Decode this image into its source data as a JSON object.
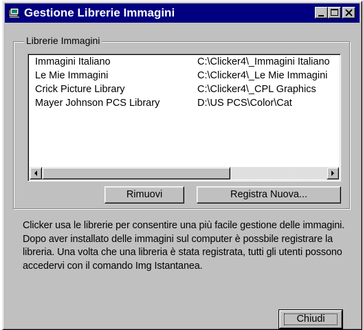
{
  "window": {
    "title": "Gestione Librerie Immagini",
    "icon": "app-icon"
  },
  "title_buttons": {
    "minimize_icon": "minimize-icon",
    "maximize_icon": "maximize-icon",
    "close_icon": "close-icon"
  },
  "group": {
    "label": "Librerie Immagini"
  },
  "libraries": [
    {
      "name": "Immagini Italiano",
      "path": "C:\\Clicker4\\_Immagini Italiano"
    },
    {
      "name": "Le Mie Immagini",
      "path": "C:\\Clicker4\\_Le Mie Immagini"
    },
    {
      "name": "Crick Picture Library",
      "path": "C:\\Clicker4\\_CPL Graphics"
    },
    {
      "name": "Mayer Johnson PCS Library",
      "path": "D:\\US PCS\\Color\\Cat"
    }
  ],
  "buttons": {
    "remove": "Rimuovi",
    "register": "Registra Nuova...",
    "close": "Chiudi"
  },
  "description": [
    "Clicker usa le librerie per consentire una più facile gestione delle immagini.",
    "Dopo aver installato delle immagini sul computer è possbile registrare la",
    "libreria. Una volta che una libreria è stata registrata, tutti gli utenti possono",
    "accedervi con il comando Img Istantanea."
  ],
  "colors": {
    "titlebar": "#000080",
    "face": "#c0c0c0"
  }
}
